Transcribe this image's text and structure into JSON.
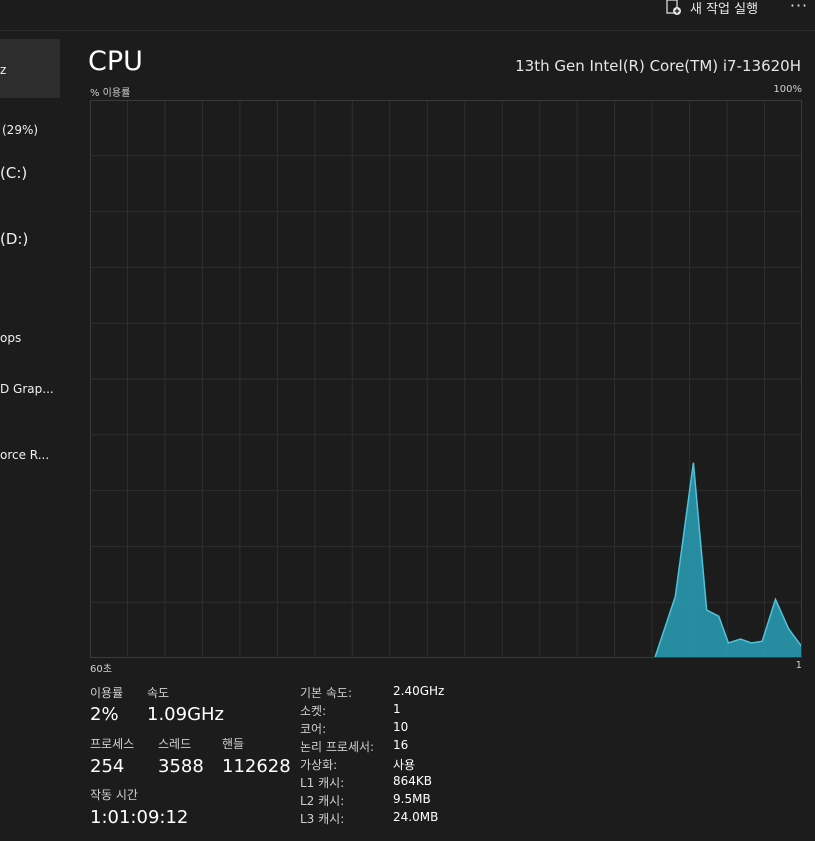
{
  "toolbar": {
    "run_task_label": "새 작업 실행",
    "more_label": "···"
  },
  "sidebar": {
    "items": [
      {
        "label": "z"
      },
      {
        "label": "(29%)"
      },
      {
        "label": "(C:)"
      },
      {
        "label": "(D:)"
      },
      {
        "label": "ops"
      },
      {
        "label": "D Grap..."
      },
      {
        "label": "orce R..."
      }
    ]
  },
  "header": {
    "title": "CPU",
    "model": "13th Gen Intel(R) Core(TM) i7-13620H"
  },
  "chart_data": {
    "type": "area",
    "ylabel": "% 이용률",
    "ymax_label": "100%",
    "xmin_label": "60초",
    "xmax_label": "1",
    "ylim": [
      0,
      100
    ],
    "xlim": [
      60,
      1
    ],
    "grid": true,
    "color": "#2aa0b8",
    "x": [
      60,
      13.2,
      11.5,
      10.0,
      8.9,
      7.9,
      7.1,
      6.1,
      5.2,
      4.3,
      3.2,
      2.1,
      1.0
    ],
    "values": [
      0,
      0,
      11,
      35,
      8.6,
      7.5,
      2.7,
      3.4,
      2.7,
      3.0,
      10.5,
      5.2,
      2.0
    ]
  },
  "stats": {
    "utilization": {
      "label": "이용률",
      "value": "2%"
    },
    "speed": {
      "label": "속도",
      "value": "1.09GHz"
    },
    "processes": {
      "label": "프로세스",
      "value": "254"
    },
    "threads": {
      "label": "스레드",
      "value": "3588"
    },
    "handles": {
      "label": "핸들",
      "value": "112628"
    },
    "uptime": {
      "label": "작동 시간",
      "value": "1:01:09:12"
    }
  },
  "specs": [
    {
      "label": "기본 속도:",
      "value": "2.40GHz"
    },
    {
      "label": "소켓:",
      "value": "1"
    },
    {
      "label": "코어:",
      "value": "10"
    },
    {
      "label": "논리 프로세서:",
      "value": "16"
    },
    {
      "label": "가상화:",
      "value": "사용"
    },
    {
      "label": "L1 캐시:",
      "value": "864KB"
    },
    {
      "label": "L2 캐시:",
      "value": "9.5MB"
    },
    {
      "label": "L3 캐시:",
      "value": "24.0MB"
    }
  ]
}
